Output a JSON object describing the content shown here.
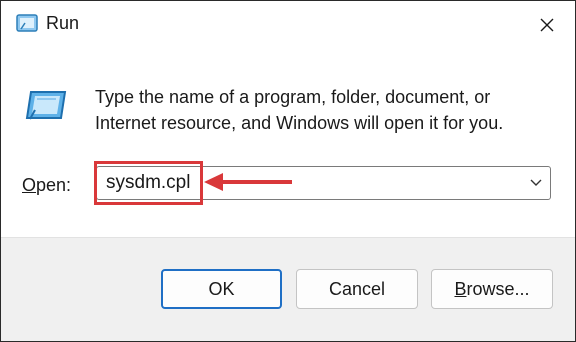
{
  "window": {
    "title": "Run",
    "title_icon": "run-icon",
    "close_icon": "close-icon"
  },
  "body": {
    "icon": "run-icon",
    "description": "Type the name of a program, folder, document, or Internet resource, and Windows will open it for you."
  },
  "open": {
    "label_mnemonic": "O",
    "label_rest": "pen:",
    "value": "sysdm.cpl",
    "dropdown_icon": "chevron-down-icon"
  },
  "annotation": {
    "highlight_color": "#d9383a",
    "arrow_icon": "arrow-left-icon"
  },
  "buttons": {
    "ok": "OK",
    "cancel": "Cancel",
    "browse_mnemonic": "B",
    "browse_rest": "rowse..."
  },
  "colors": {
    "accent": "#1f6fc5",
    "footer": "#f0f0f0",
    "annotation": "#d9383a"
  }
}
